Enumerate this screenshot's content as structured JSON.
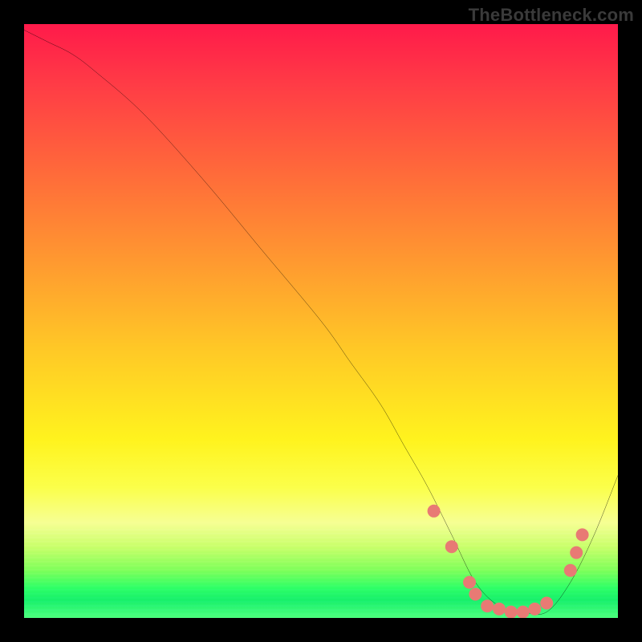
{
  "watermark": "TheBottleneck.com",
  "chart_data": {
    "type": "line",
    "title": "",
    "xlabel": "",
    "ylabel": "",
    "xlim": [
      0,
      100
    ],
    "ylim": [
      0,
      100
    ],
    "grid": false,
    "legend": false,
    "series": [
      {
        "name": "bottleneck-curve",
        "color": "#000000",
        "x": [
          0,
          4,
          8,
          12,
          20,
          30,
          40,
          50,
          55,
          60,
          64,
          68,
          72,
          76,
          80,
          84,
          88,
          92,
          96,
          100
        ],
        "y": [
          99,
          97,
          95,
          92,
          85,
          74,
          62,
          50,
          43,
          36,
          29,
          22,
          14,
          6,
          2,
          1,
          1,
          6,
          14,
          24
        ]
      }
    ],
    "markers": [
      {
        "name": "highlight-dots",
        "color": "#e87a74",
        "radius": 8,
        "points": [
          {
            "x": 69,
            "y": 18
          },
          {
            "x": 72,
            "y": 12
          },
          {
            "x": 75,
            "y": 6
          },
          {
            "x": 76,
            "y": 4
          },
          {
            "x": 78,
            "y": 2
          },
          {
            "x": 80,
            "y": 1.5
          },
          {
            "x": 82,
            "y": 1
          },
          {
            "x": 84,
            "y": 1
          },
          {
            "x": 86,
            "y": 1.5
          },
          {
            "x": 88,
            "y": 2.5
          },
          {
            "x": 92,
            "y": 8
          },
          {
            "x": 93,
            "y": 11
          },
          {
            "x": 94,
            "y": 14
          }
        ]
      }
    ]
  }
}
